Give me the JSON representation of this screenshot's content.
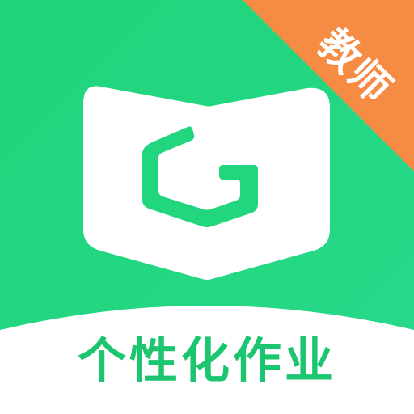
{
  "app_icon": {
    "badge_label": "教师",
    "caption": "个性化作业",
    "logo_icon": "book-with-g-logo-icon",
    "colors": {
      "primary_green": "#22d67d",
      "caption_green": "#1cc56f",
      "badge_orange": "#f68c44",
      "logo_white": "#ffffff",
      "lower_white": "#ffffff"
    }
  }
}
